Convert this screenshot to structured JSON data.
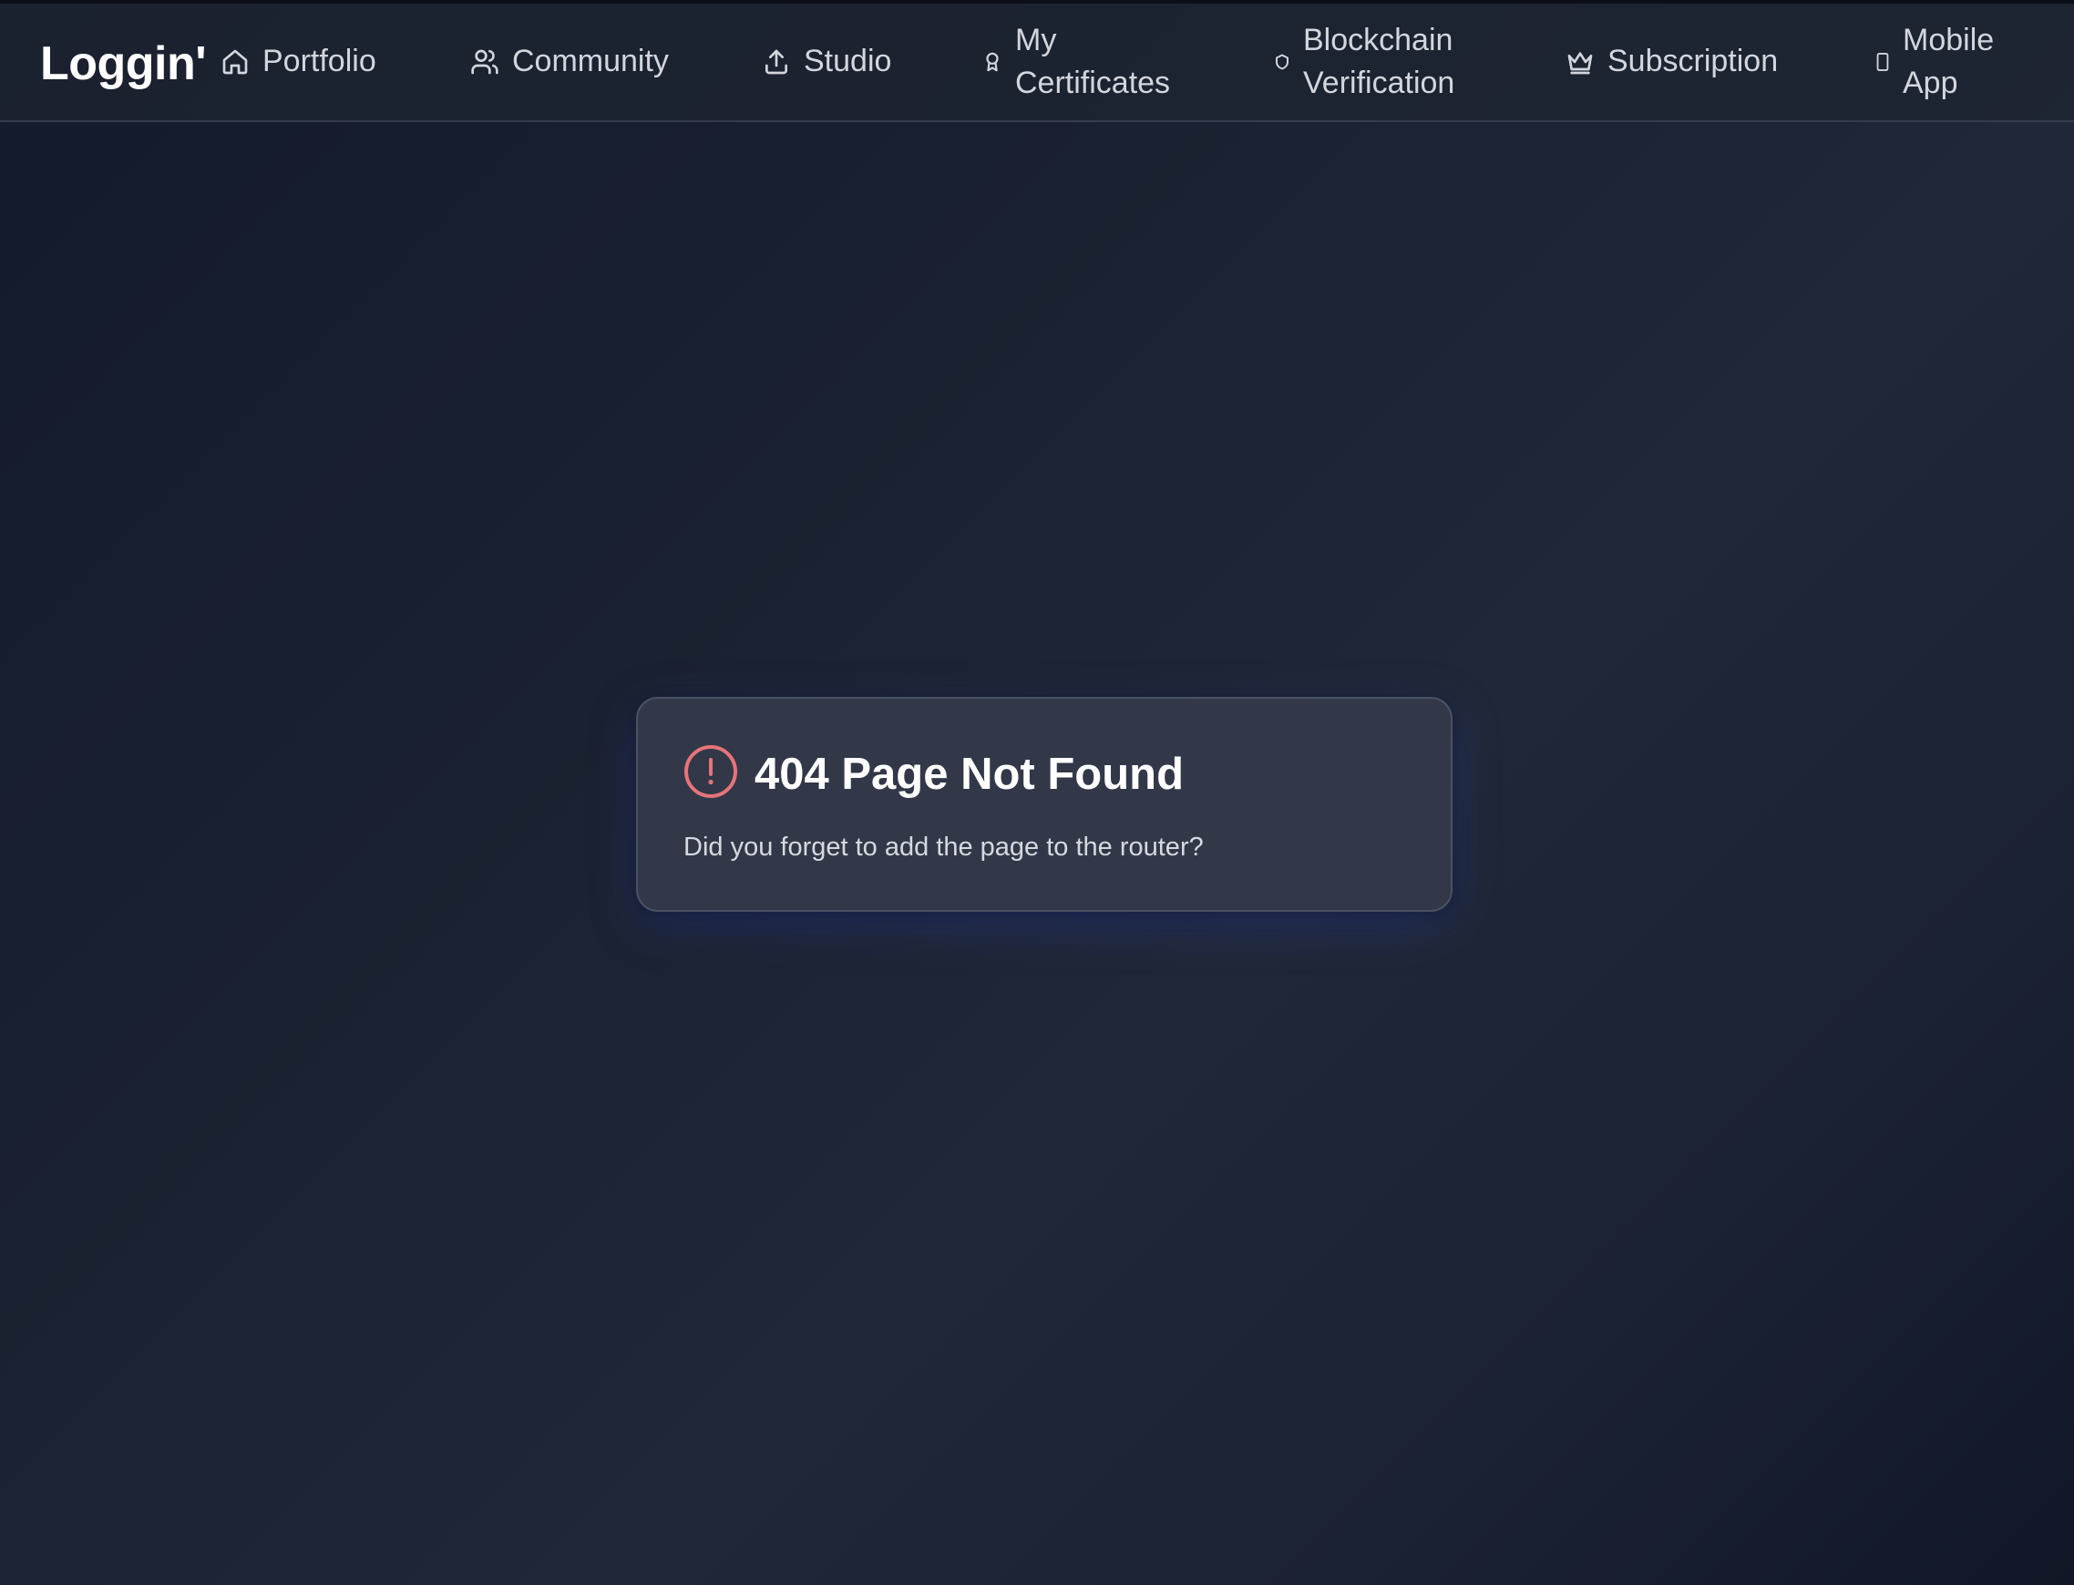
{
  "app": {
    "logo": "Loggin'"
  },
  "nav": {
    "items": [
      {
        "label": "Portfolio",
        "icon": "home-icon"
      },
      {
        "label": "Community",
        "icon": "users-icon"
      },
      {
        "label": "Studio",
        "icon": "upload-icon"
      },
      {
        "label": "My Certificates",
        "icon": "award-icon"
      },
      {
        "label": "Blockchain Verification",
        "icon": "shield-icon"
      },
      {
        "label": "Subscription",
        "icon": "crown-icon"
      },
      {
        "label": "Mobile App",
        "icon": "smartphone-icon"
      }
    ]
  },
  "error": {
    "icon": "alert-circle-icon",
    "title": "404 Page Not Found",
    "message": "Did you forget to add the page to the router?"
  },
  "colors": {
    "background": "#1a2130",
    "navbar": "#1e2432",
    "card": "#323848",
    "error_icon": "#e5747a",
    "text_primary": "#ffffff",
    "text_secondary": "#d3d6dd"
  }
}
